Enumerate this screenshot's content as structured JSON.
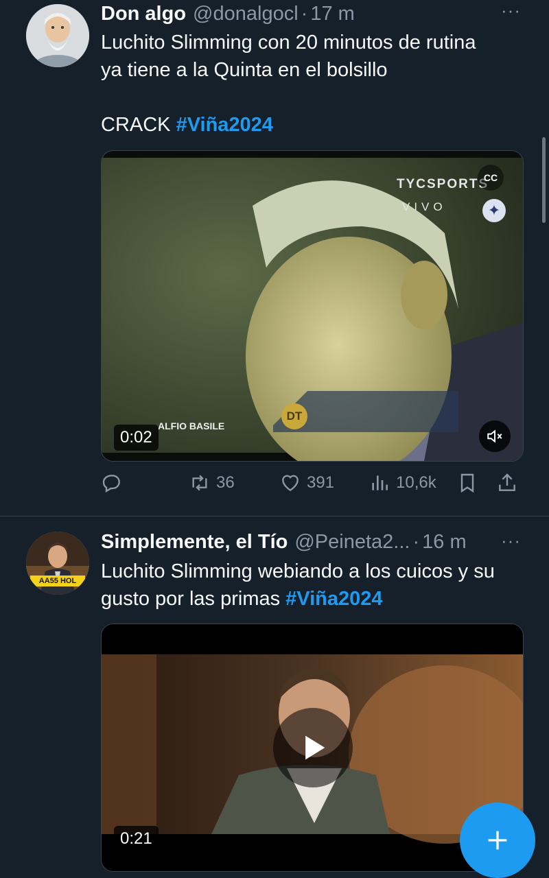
{
  "tweets": [
    {
      "name": "Don algo",
      "handle": "@donalgocl",
      "dot": "·",
      "time": "17 m",
      "more": "···",
      "text_line1": "Luchito Slimming con 20 minutos de rutina",
      "text_line2": "ya tiene a la Quinta en el bolsillo",
      "text_line3": "CRACK ",
      "hashtag": "#Viña2024",
      "video": {
        "duration": "0:02",
        "broadcaster": "TYCSPORTS",
        "live_label": "VIVO",
        "lower_third_name": "ALFIO BASILE",
        "lower_third_role": "DT"
      },
      "stats": {
        "retweets": "36",
        "likes": "391",
        "views": "10,6k"
      }
    },
    {
      "name": "Simplemente, el Tío",
      "handle": "@Peineta2...",
      "dot": "·",
      "time": "16 m",
      "more": "···",
      "text_line1": "Luchito Slimming webiando a los cuicos y su",
      "text_line2_prefix": "gusto por las primas ",
      "hashtag": "#Viña2024",
      "avatar_sign": "AA55 HOL",
      "video": {
        "duration": "0:21"
      }
    }
  ],
  "colors": {
    "background": "#15202b",
    "accent": "#1d9bf0",
    "muted": "#8b98a5",
    "divider": "#38444d"
  },
  "icons": [
    "reply-icon",
    "retweet-icon",
    "like-icon",
    "views-icon",
    "bookmark-icon",
    "share-icon",
    "mute-icon",
    "captions-icon",
    "play-icon",
    "plus-icon"
  ]
}
